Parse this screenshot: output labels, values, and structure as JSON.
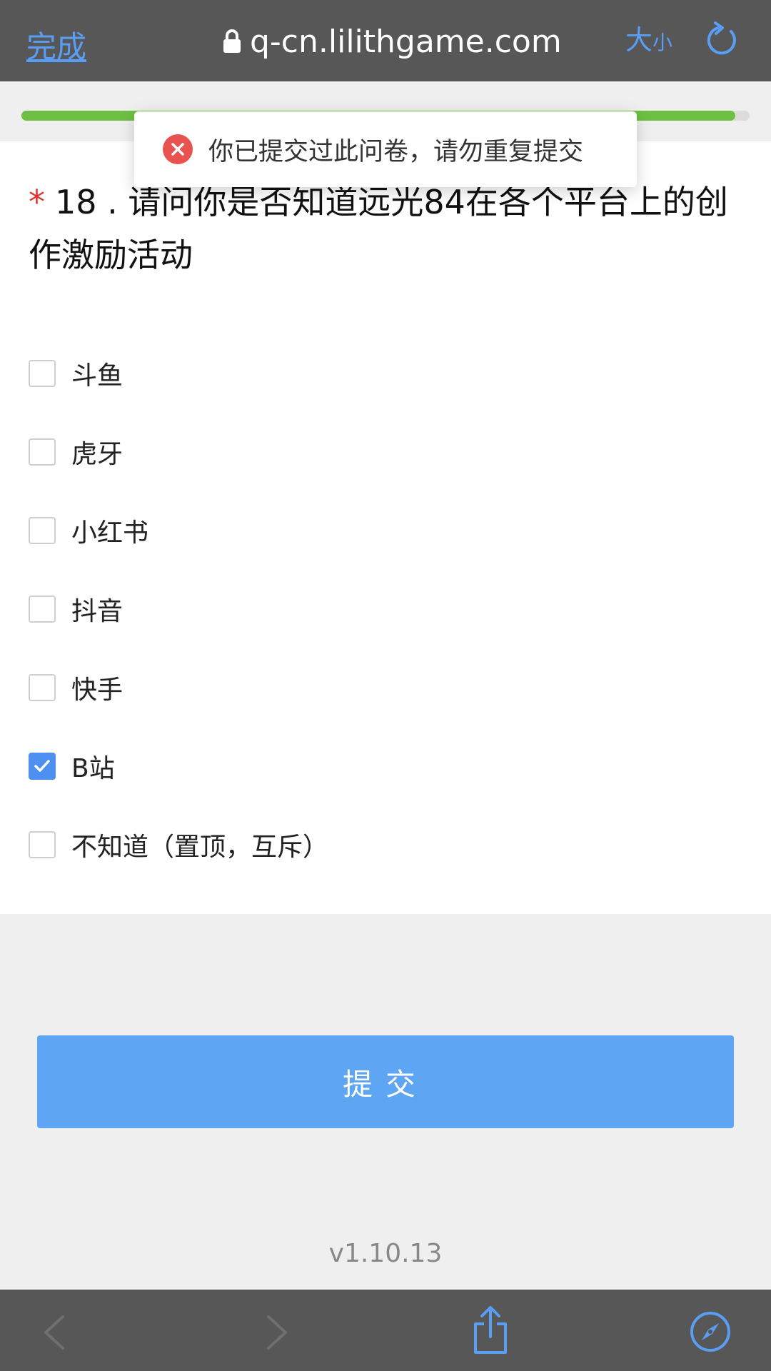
{
  "browser": {
    "done_label": "完成",
    "url": "q-cn.lilithgame.com",
    "text_size_large": "大",
    "text_size_small": "小",
    "icons": {
      "lock": "lock-icon",
      "reload": "reload-icon",
      "back": "back-icon",
      "forward": "forward-icon",
      "share": "share-icon",
      "compass": "compass-icon"
    }
  },
  "progress": {
    "fraction": 0.98,
    "color": "#6dc043"
  },
  "toast": {
    "message": "你已提交过此问卷，请勿重复提交",
    "icon": "error-icon",
    "icon_color": "#e9534f"
  },
  "question": {
    "required_mark": "*",
    "text": "18 . 请问你是否知道远光84在各个平台上的创作激励活动",
    "options": [
      {
        "label": "斗鱼",
        "checked": false
      },
      {
        "label": "虎牙",
        "checked": false
      },
      {
        "label": "小红书",
        "checked": false
      },
      {
        "label": "抖音",
        "checked": false
      },
      {
        "label": "快手",
        "checked": false
      },
      {
        "label": "B站",
        "checked": true
      },
      {
        "label": "不知道（置顶，互斥）",
        "checked": false
      }
    ]
  },
  "submit": {
    "label": "提交",
    "color": "#5ea6f4"
  },
  "footer": {
    "version": "v1.10.13"
  },
  "colors": {
    "accent": "#4d90f1",
    "link": "#5a9df5",
    "required": "#e2342f"
  }
}
